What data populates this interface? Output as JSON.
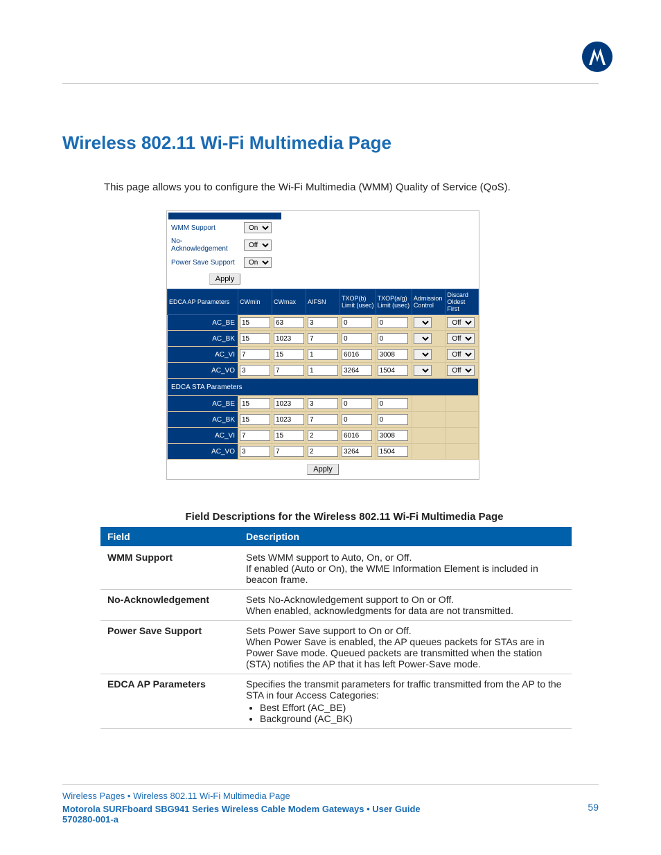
{
  "title": "Wireless 802.11 Wi-Fi Multimedia Page",
  "intro": "This page allows you to configure the Wi-Fi Multimedia (WMM) Quality of Service (QoS).",
  "settings": {
    "wmm_support": {
      "label": "WMM Support",
      "value": "On"
    },
    "no_ack": {
      "label": "No-Acknowledgement",
      "value": "Off"
    },
    "power_save": {
      "label": "Power Save Support",
      "value": "On"
    },
    "apply": "Apply"
  },
  "headers": {
    "edca_ap": "EDCA AP Parameters",
    "edca_sta": "EDCA STA Parameters",
    "cwmin": "CWmin",
    "cwmax": "CWmax",
    "aifsn": "AIFSN",
    "txop_b": "TXOP(b) Limit (usec)",
    "txop_ag": "TXOP(a/g) Limit (usec)",
    "adm": "Admission Control",
    "discard": "Discard Oldest First"
  },
  "ap_rows": [
    {
      "name": "AC_BE",
      "cwmin": "15",
      "cwmax": "63",
      "aifsn": "3",
      "txb": "0",
      "txag": "0",
      "adm": "",
      "disc": "Off"
    },
    {
      "name": "AC_BK",
      "cwmin": "15",
      "cwmax": "1023",
      "aifsn": "7",
      "txb": "0",
      "txag": "0",
      "adm": "",
      "disc": "Off"
    },
    {
      "name": "AC_VI",
      "cwmin": "7",
      "cwmax": "15",
      "aifsn": "1",
      "txb": "6016",
      "txag": "3008",
      "adm": "",
      "disc": "Off"
    },
    {
      "name": "AC_VO",
      "cwmin": "3",
      "cwmax": "7",
      "aifsn": "1",
      "txb": "3264",
      "txag": "1504",
      "adm": "",
      "disc": "Off"
    }
  ],
  "sta_rows": [
    {
      "name": "AC_BE",
      "cwmin": "15",
      "cwmax": "1023",
      "aifsn": "3",
      "txb": "0",
      "txag": "0"
    },
    {
      "name": "AC_BK",
      "cwmin": "15",
      "cwmax": "1023",
      "aifsn": "7",
      "txb": "0",
      "txag": "0"
    },
    {
      "name": "AC_VI",
      "cwmin": "7",
      "cwmax": "15",
      "aifsn": "2",
      "txb": "6016",
      "txag": "3008"
    },
    {
      "name": "AC_VO",
      "cwmin": "3",
      "cwmax": "7",
      "aifsn": "2",
      "txb": "3264",
      "txag": "1504"
    }
  ],
  "apply_bottom": "Apply",
  "desc_caption": "Field Descriptions for the Wireless 802.11 Wi-Fi Multimedia Page",
  "desc_headers": {
    "field": "Field",
    "desc": "Description"
  },
  "desc_rows": [
    {
      "field": "WMM Support",
      "desc": "Sets WMM support to Auto, On, or Off.\nIf enabled (Auto or On), the WME Information Element is included in beacon frame."
    },
    {
      "field": "No-Acknowledgement",
      "desc": "Sets No-Acknowledgement support to On or Off.\nWhen enabled, acknowledgments for data are not transmitted."
    },
    {
      "field": "Power Save Support",
      "desc": "Sets Power Save support to On or Off.\nWhen Power Save is enabled, the AP queues packets for STAs are in Power Save mode. Queued packets are transmitted when the station (STA) notifies the AP that it has left Power-Save mode."
    },
    {
      "field": "EDCA AP Parameters",
      "desc_intro": "Specifies the transmit parameters for traffic transmitted from the AP to the STA in four Access Categories:",
      "bullets": [
        "Best Effort (AC_BE)",
        "Background (AC_BK)"
      ]
    }
  ],
  "footer": {
    "breadcrumb": "Wireless Pages • Wireless 802.11 Wi-Fi Multimedia Page",
    "product": "Motorola SURFboard SBG941 Series Wireless Cable Modem Gateways • User Guide",
    "docnum": "570280-001-a",
    "page": "59"
  }
}
